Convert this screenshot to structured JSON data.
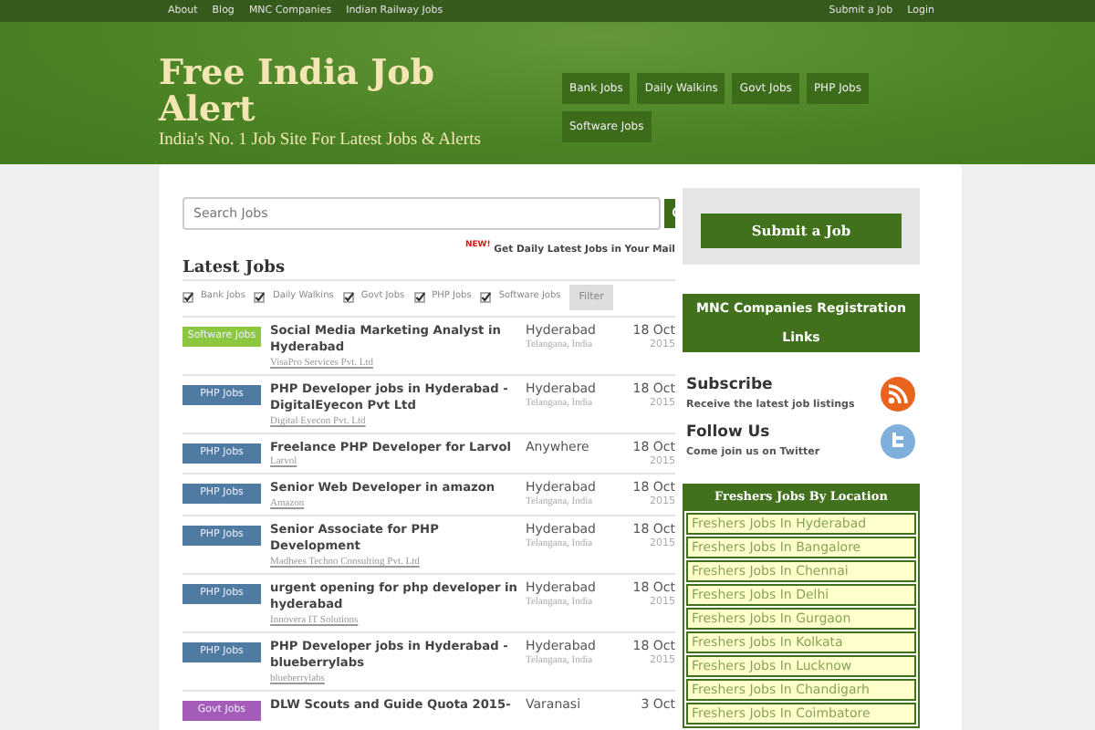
{
  "top_nav": {
    "left": [
      "About",
      "Blog",
      "MNC Companies",
      "Indian Railway Jobs"
    ],
    "right": [
      "Submit a Job",
      "Login"
    ]
  },
  "header": {
    "title": "Free India Job Alert",
    "subtitle": "India's No. 1 Job Site For Latest Jobs & Alerts",
    "categories": [
      "Bank Jobs",
      "Daily Walkins",
      "Govt Jobs",
      "PHP Jobs",
      "Software Jobs"
    ]
  },
  "search": {
    "placeholder": "Search Jobs"
  },
  "newsletter": {
    "badge": "NEW!",
    "text": "Get Daily Latest Jobs in Your Mail"
  },
  "latest_jobs": {
    "title": "Latest Jobs",
    "filters": [
      {
        "label": "Bank Jobs",
        "checked": true
      },
      {
        "label": "Daily Walkins",
        "checked": true
      },
      {
        "label": "Govt Jobs",
        "checked": true
      },
      {
        "label": "PHP Jobs",
        "checked": true
      },
      {
        "label": "Software Jobs",
        "checked": true
      }
    ],
    "filter_button": "Filter",
    "jobs": [
      {
        "category": "Software Jobs",
        "color": "#8dc63f",
        "title": "Social Media Marketing Analyst in Hyderabad",
        "company": "VisaPro Services Pvt. Ltd",
        "location": "Hyderabad",
        "region": "Telangana, India",
        "date": "18 Oct",
        "year": "2015"
      },
      {
        "category": "PHP Jobs",
        "color": "#4f7ba3",
        "title": "PHP Developer jobs in Hyderabad - DigitalEyecon Pvt Ltd",
        "company": "Digital Eyecon Pvt. Ltd",
        "location": "Hyderabad",
        "region": "Telangana, India",
        "date": "18 Oct",
        "year": "2015"
      },
      {
        "category": "PHP Jobs",
        "color": "#4f7ba3",
        "title": "Freelance PHP Developer for Larvol",
        "company": "Larvol",
        "location": "Anywhere",
        "date": "18 Oct",
        "year": "2015"
      },
      {
        "category": "PHP Jobs",
        "color": "#4f7ba3",
        "title": "Senior Web Developer in amazon",
        "company": "Amazon",
        "location": "Hyderabad",
        "region": "Telangana, India",
        "date": "18 Oct",
        "year": "2015"
      },
      {
        "category": "PHP Jobs",
        "color": "#4f7ba3",
        "title": "Senior Associate for PHP Development",
        "company": "Madhees Techno Consulting Pvt. Ltd",
        "location": "Hyderabad",
        "region": "Telangana, India",
        "date": "18 Oct",
        "year": "2015"
      },
      {
        "category": "PHP Jobs",
        "color": "#4f7ba3",
        "title": "urgent opening for php developer in hyderabad",
        "company": "Innovera IT Solutions",
        "location": "Hyderabad",
        "region": "Telangana, India",
        "date": "18 Oct",
        "year": "2015"
      },
      {
        "category": "PHP Jobs",
        "color": "#4f7ba3",
        "title": "PHP Developer jobs in Hyderabad - blueberrylabs",
        "company": "blueberrylabs",
        "location": "Hyderabad",
        "region": "Telangana, India",
        "date": "18 Oct",
        "year": "2015"
      },
      {
        "category": "Govt Jobs",
        "color": "#a45cb8",
        "title": "DLW Scouts and Guide Quota 2015-",
        "location": "Varanasi",
        "date": "3 Oct"
      }
    ]
  },
  "sidebar": {
    "submit_button": "Submit a Job",
    "mnc_box": "MNC Companies Registration Links",
    "subscribe": {
      "title": "Subscribe",
      "text": "Receive the latest job listings"
    },
    "follow": {
      "title": "Follow Us",
      "text": "Come join us on Twitter"
    },
    "freshers": {
      "title": "Freshers Jobs By Location",
      "links": [
        "Freshers Jobs In Hyderabad",
        "Freshers Jobs In Bangalore",
        "Freshers Jobs In Chennai",
        "Freshers Jobs In Delhi",
        "Freshers Jobs In Gurgaon",
        "Freshers Jobs In Kolkata",
        "Freshers Jobs In Lucknow",
        "Freshers Jobs In Chandigarh",
        "Freshers Jobs In Coimbatore"
      ]
    }
  }
}
